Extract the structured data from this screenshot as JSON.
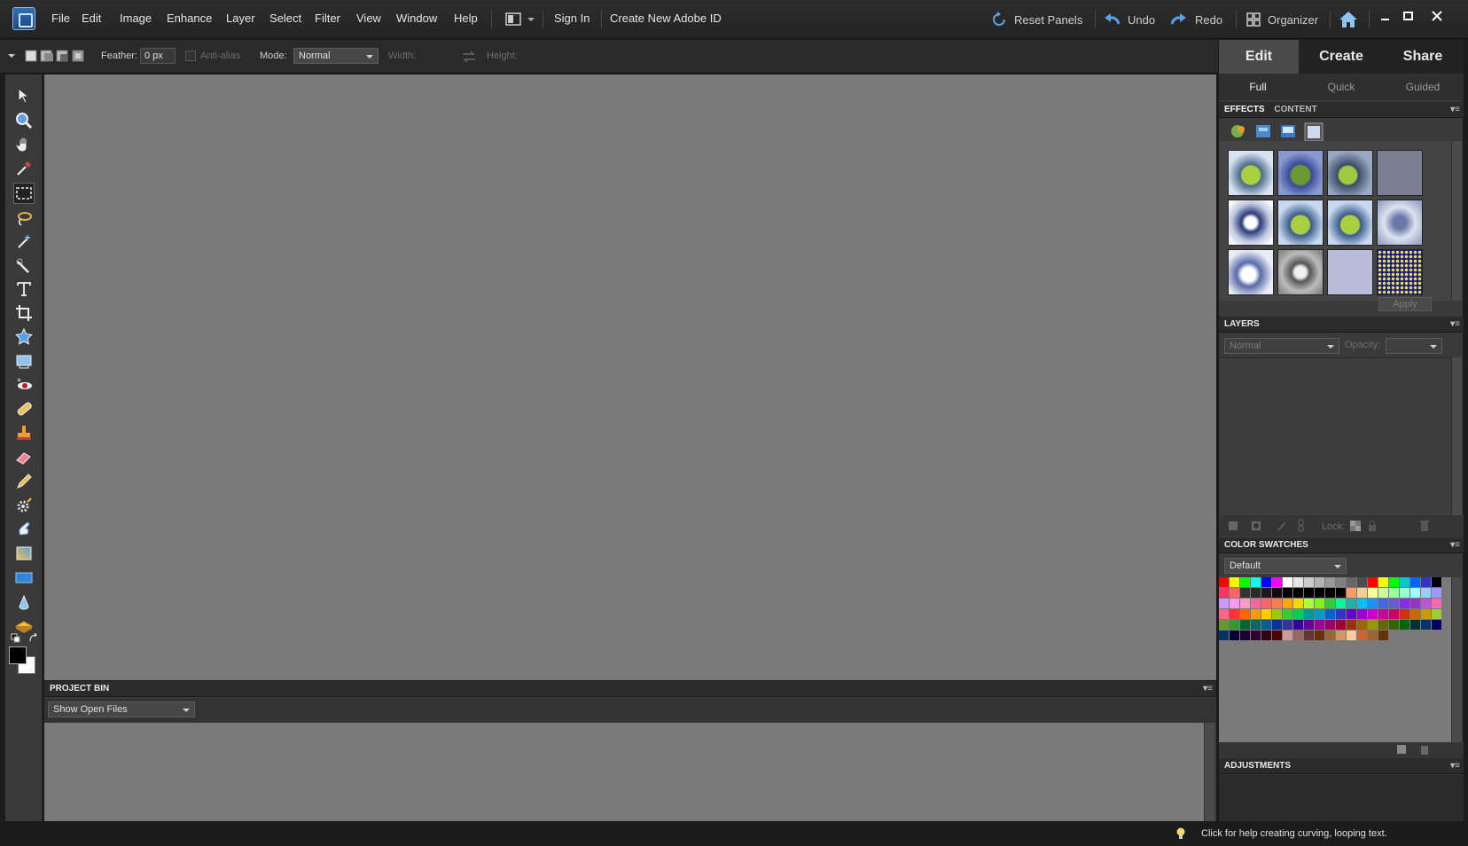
{
  "menubar": {
    "items": [
      "File",
      "Edit",
      "Image",
      "Enhance",
      "Layer",
      "Select",
      "Filter",
      "View",
      "Window",
      "Help"
    ],
    "sign_in": "Sign In",
    "create_id": "Create New Adobe ID",
    "reset_panels": "Reset Panels",
    "undo": "Undo",
    "redo": "Redo",
    "organizer": "Organizer"
  },
  "options": {
    "feather_label": "Feather:",
    "feather_value": "0 px",
    "antialias_label": "Anti-alias",
    "mode_label": "Mode:",
    "mode_value": "Normal",
    "width_label": "Width:",
    "height_label": "Height:"
  },
  "modes": {
    "tabs": [
      "Edit",
      "Create",
      "Share"
    ],
    "active_tab": "Edit",
    "subtabs": [
      "Full",
      "Quick",
      "Guided"
    ],
    "active_subtab": "Full"
  },
  "effects_panel": {
    "tabs": [
      "EFFECTS",
      "CONTENT"
    ],
    "apply": "Apply"
  },
  "layers_panel": {
    "title": "LAYERS",
    "blend_mode": "Normal",
    "opacity_label": "Opacity:",
    "lock_label": "Lock:"
  },
  "swatches_panel": {
    "title": "COLOR SWATCHES",
    "preset": "Default",
    "colors": [
      "#ff0000",
      "#ffff00",
      "#00ff00",
      "#00ffff",
      "#0000ff",
      "#ff00ff",
      "#ffffff",
      "#e6e6e6",
      "#cccccc",
      "#b3b3b3",
      "#999999",
      "#808080",
      "#666666",
      "#4d4d4d",
      "#ff0000",
      "#ffff00",
      "#00ff00",
      "#00c8c8",
      "#0064ff",
      "#3232c8",
      "#000000",
      "#ff3366",
      "#ff6666",
      "#333333",
      "#2a2a2a",
      "#1a1a1a",
      "#0d0d0d",
      "#000000",
      "#000000",
      "#000000",
      "#000000",
      "#000000",
      "#000000",
      "#ff9966",
      "#ffcc99",
      "#ffff99",
      "#ccff99",
      "#99ff99",
      "#99ffcc",
      "#99ffff",
      "#99ccff",
      "#9999ff",
      "#cc99ff",
      "#ff99ff",
      "#ff99cc",
      "#ff6699",
      "#ff6666",
      "#ff7f50",
      "#ffa500",
      "#ffd700",
      "#adff2f",
      "#7fff00",
      "#32cd32",
      "#00fa9a",
      "#20b2aa",
      "#00bfff",
      "#1e90ff",
      "#4169e1",
      "#6a5acd",
      "#8a2be2",
      "#9932cc",
      "#ba55d3",
      "#ff69b4",
      "#ff6688",
      "#ff3333",
      "#ff6600",
      "#ff9900",
      "#ffcc00",
      "#99cc00",
      "#33cc33",
      "#00cc66",
      "#009999",
      "#0099cc",
      "#0066cc",
      "#3333cc",
      "#6600cc",
      "#9900cc",
      "#cc00cc",
      "#cc0099",
      "#cc0066",
      "#cc3300",
      "#cc6600",
      "#cc9900",
      "#99cc33",
      "#669933",
      "#339933",
      "#006633",
      "#006666",
      "#005f8f",
      "#003399",
      "#333399",
      "#330099",
      "#660099",
      "#990099",
      "#990066",
      "#990033",
      "#993300",
      "#996600",
      "#999900",
      "#666600",
      "#336600",
      "#006600",
      "#003333",
      "#003366",
      "#000066",
      "#003366",
      "#000033",
      "#1a0033",
      "#330033",
      "#330019",
      "#4d0000",
      "#cc9999",
      "#996666",
      "#663333",
      "#663300",
      "#996633",
      "#cc9966",
      "#ffcc99",
      "#cc6633",
      "#996633",
      "#663300"
    ]
  },
  "adjustments_panel": {
    "title": "ADJUSTMENTS"
  },
  "project_bin": {
    "title": "PROJECT BIN",
    "show_value": "Show Open Files"
  },
  "status": {
    "tip": "Click for help creating curving, looping text."
  },
  "accent": "#4a90d9"
}
